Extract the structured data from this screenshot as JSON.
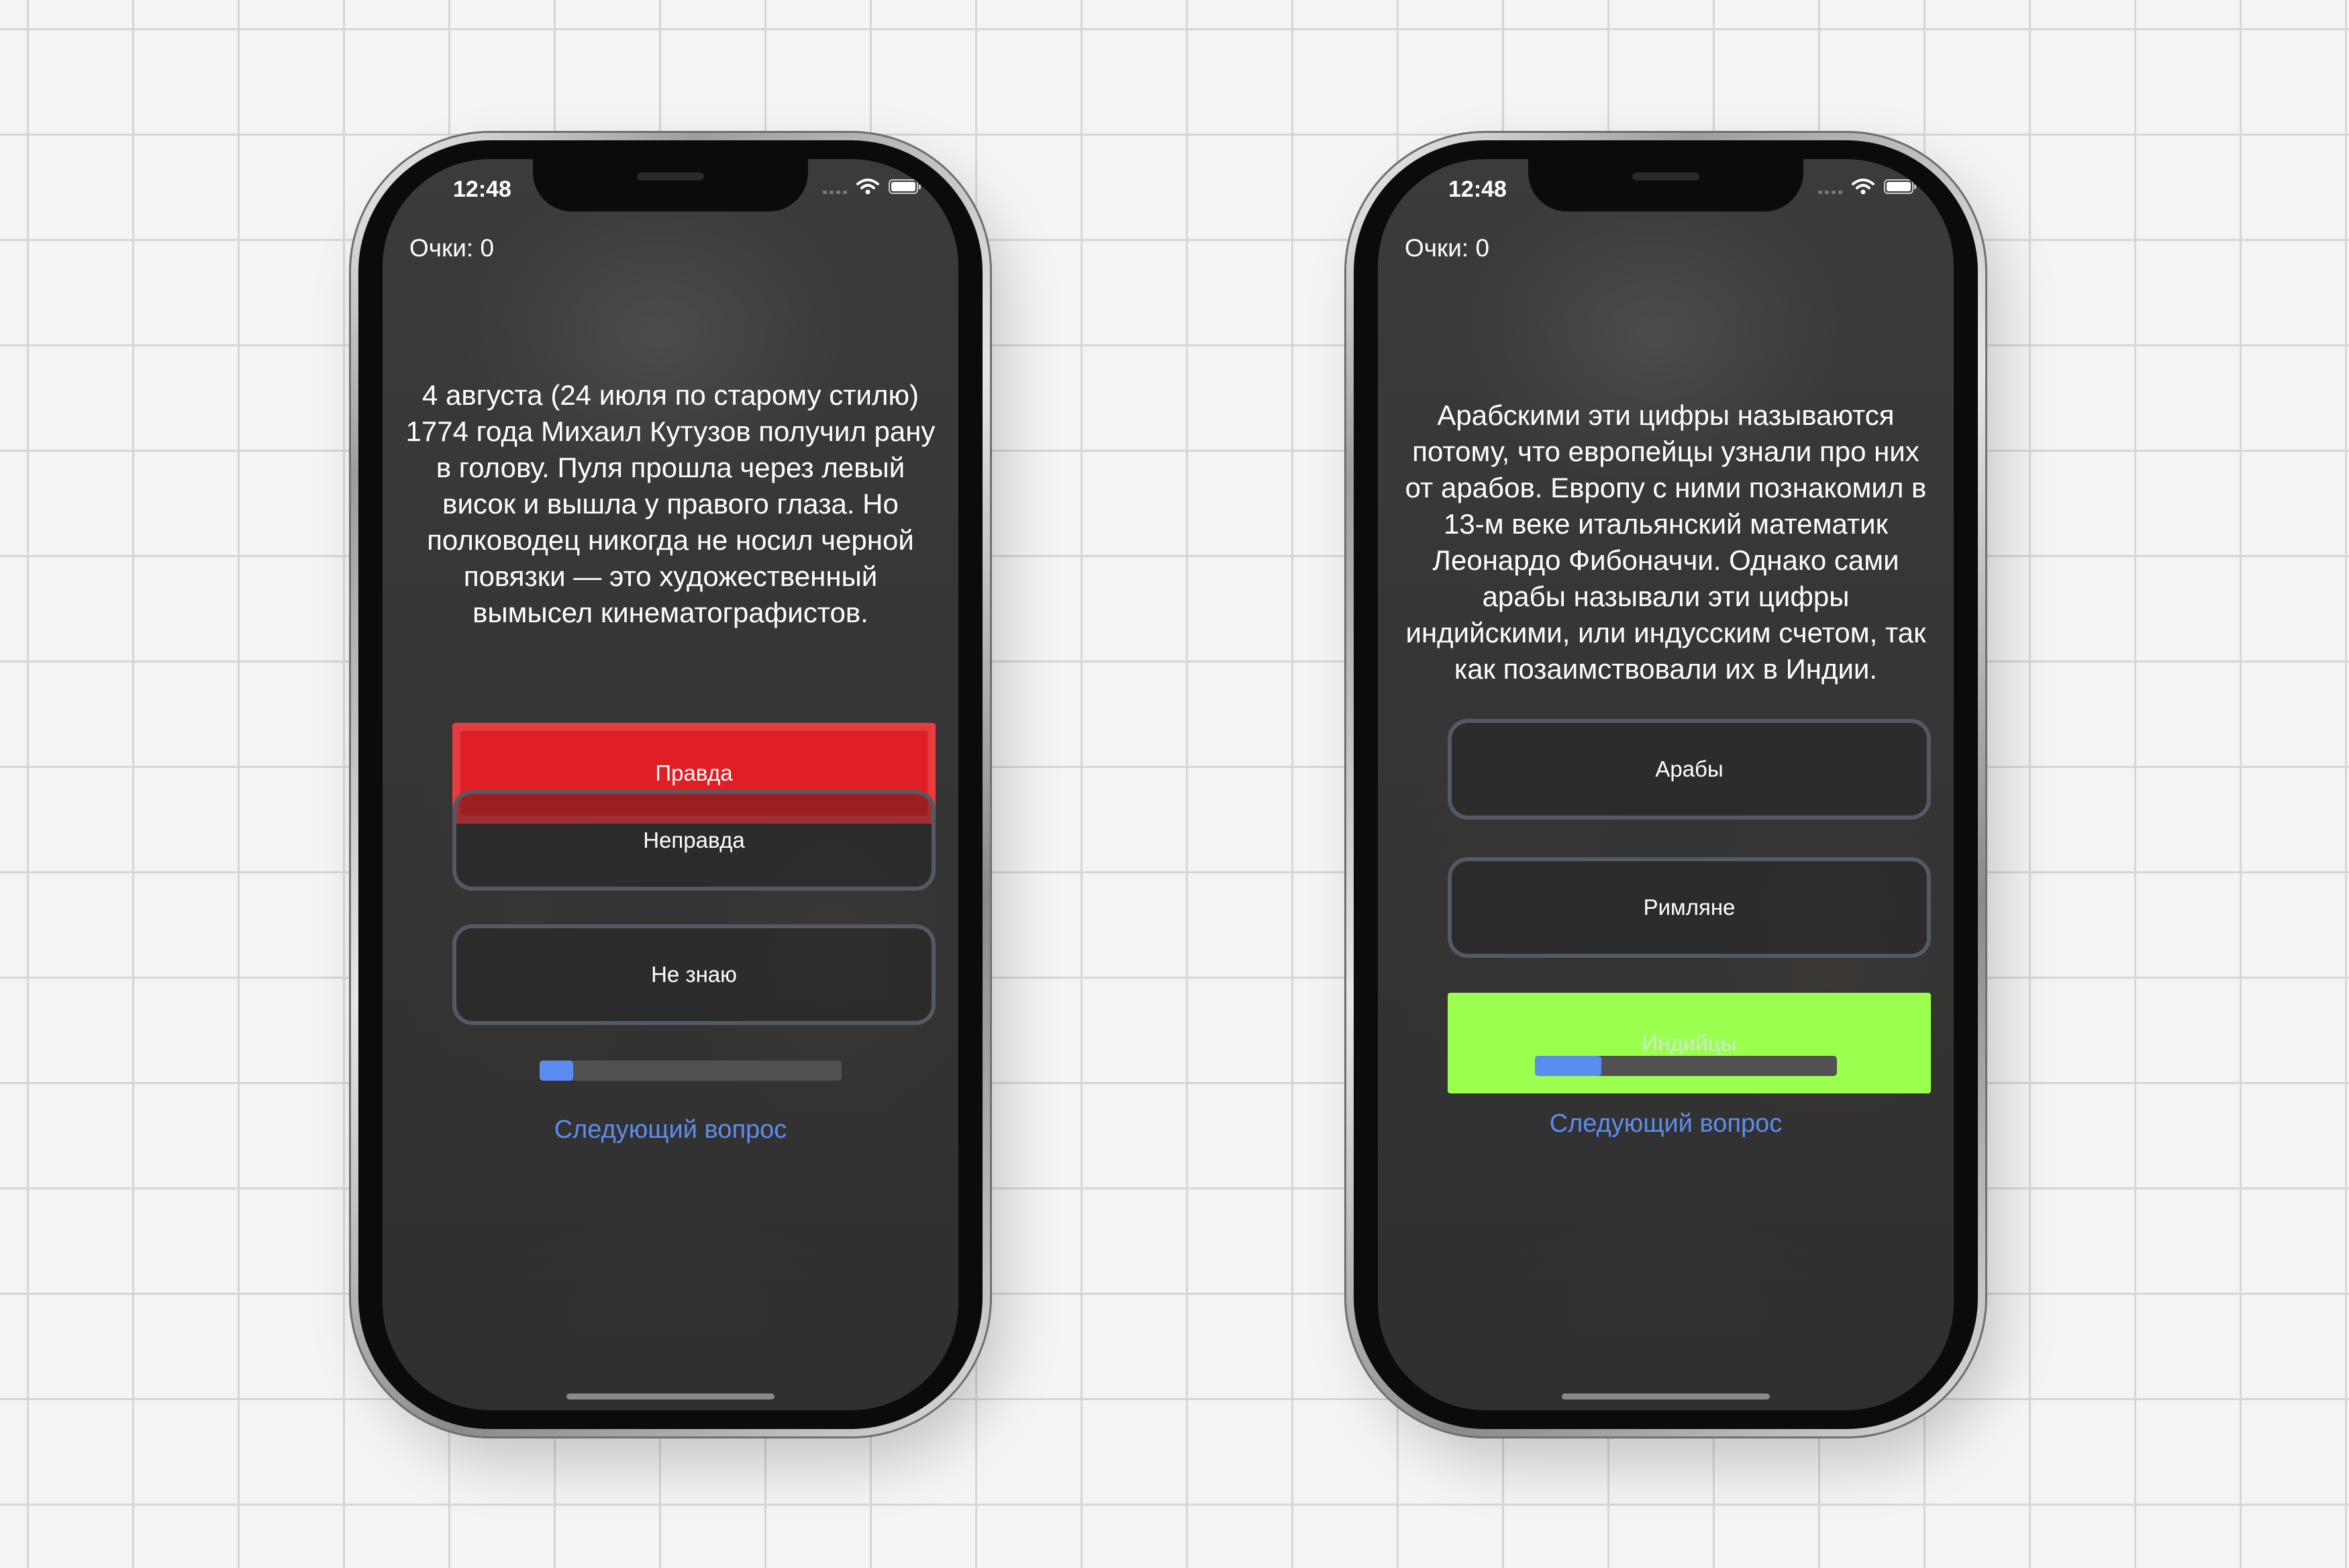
{
  "phones": [
    {
      "status": {
        "time": "12:48"
      },
      "score": "Очки: 0",
      "question": "4 августа (24 июля по старому стилю) 1774 года Михаил Кутузов получил рану в голову. Пуля прошла через левый висок и вышла у правого глаза. Но полководец никогда не носил черной повязки — это художественный вымысел кинематографистов.",
      "answers": [
        {
          "label": "Правда",
          "state": "selected-wrong",
          "color": "#e01f24"
        },
        {
          "label": "Неправда",
          "state": "default"
        },
        {
          "label": "Не знаю",
          "state": "default"
        }
      ],
      "progress": 0.11,
      "next_label": "Следующий вопрос"
    },
    {
      "status": {
        "time": "12:48"
      },
      "score": "Очки: 0",
      "question": "Арабскими эти цифры называются потому, что европейцы узнали про них от арабов. Европу с ними познакомил в 13-м веке итальянский математик Леонардо Фибоначчи. Однако сами арабы называли эти цифры индийскими, или индусским счетом, так как позаимствовали их в Индии.",
      "answers": [
        {
          "label": "Арабы",
          "state": "default"
        },
        {
          "label": "Римляне",
          "state": "default"
        },
        {
          "label": "Индийцы",
          "state": "correct",
          "color": "#9bff50"
        }
      ],
      "progress": 0.22,
      "next_label": "Следующий вопрос"
    }
  ],
  "colors": {
    "accent_link": "#5e8dee",
    "progress_fill": "#5b8cf0",
    "wrong": "#e01f24",
    "correct": "#9bff50"
  },
  "icons": [
    "signal-icon",
    "wifi-icon",
    "battery-icon"
  ]
}
